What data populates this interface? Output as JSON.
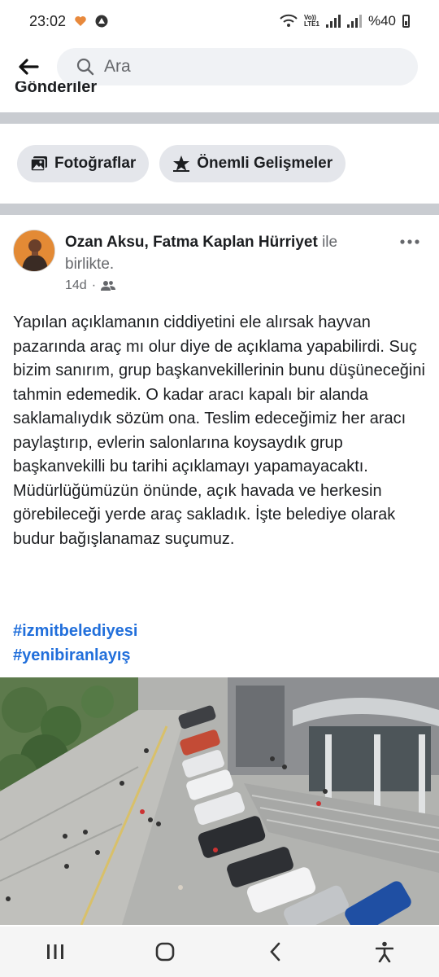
{
  "status_bar": {
    "time": "23:02",
    "network": "LTE1",
    "network_top": "Vo))",
    "battery": "%40"
  },
  "search": {
    "placeholder": "Ara"
  },
  "cut_text": "Gönderiler",
  "chips": [
    {
      "label": "Fotoğraflar",
      "icon": "photos-icon"
    },
    {
      "label": "Önemli Gelişmeler",
      "icon": "star-icon"
    }
  ],
  "post": {
    "author": "Ozan Aksu",
    "separator": ", ",
    "tagged": "Fatma Kaplan Hürriyet",
    "with_text": " ile birlikte.",
    "time": "14d",
    "dot": "·",
    "privacy_icon": "friends-icon",
    "text": "Yapılan açıklamanın ciddiyetini ele alırsak hayvan pazarında araç mı olur diye de açıklama yapabilirdi. Suç bizim sanırım, grup başkanvekillerinin bunu düşüneceğini tahmin edemedik. O kadar aracı kapalı bir alanda saklamalıydık sözüm ona. Teslim edeceğimiz her aracı paylaştırıp, evlerin salonlarına koysaydık grup başkanvekilli bu tarihi açıklamayı yapamayacaktı. Müdürlüğümüzün önünde, açık havada ve herkesin görebileceği yerde araç sakladık. İşte belediye olarak budur bağışlanamaz suçumuz.",
    "hashtags": [
      "#izmitbelediyesi",
      "#yenibiranlayış"
    ]
  },
  "colors": {
    "hashtag": "#216fdb",
    "divider": "#c9ccd1",
    "chip_bg": "#e4e6eb"
  }
}
